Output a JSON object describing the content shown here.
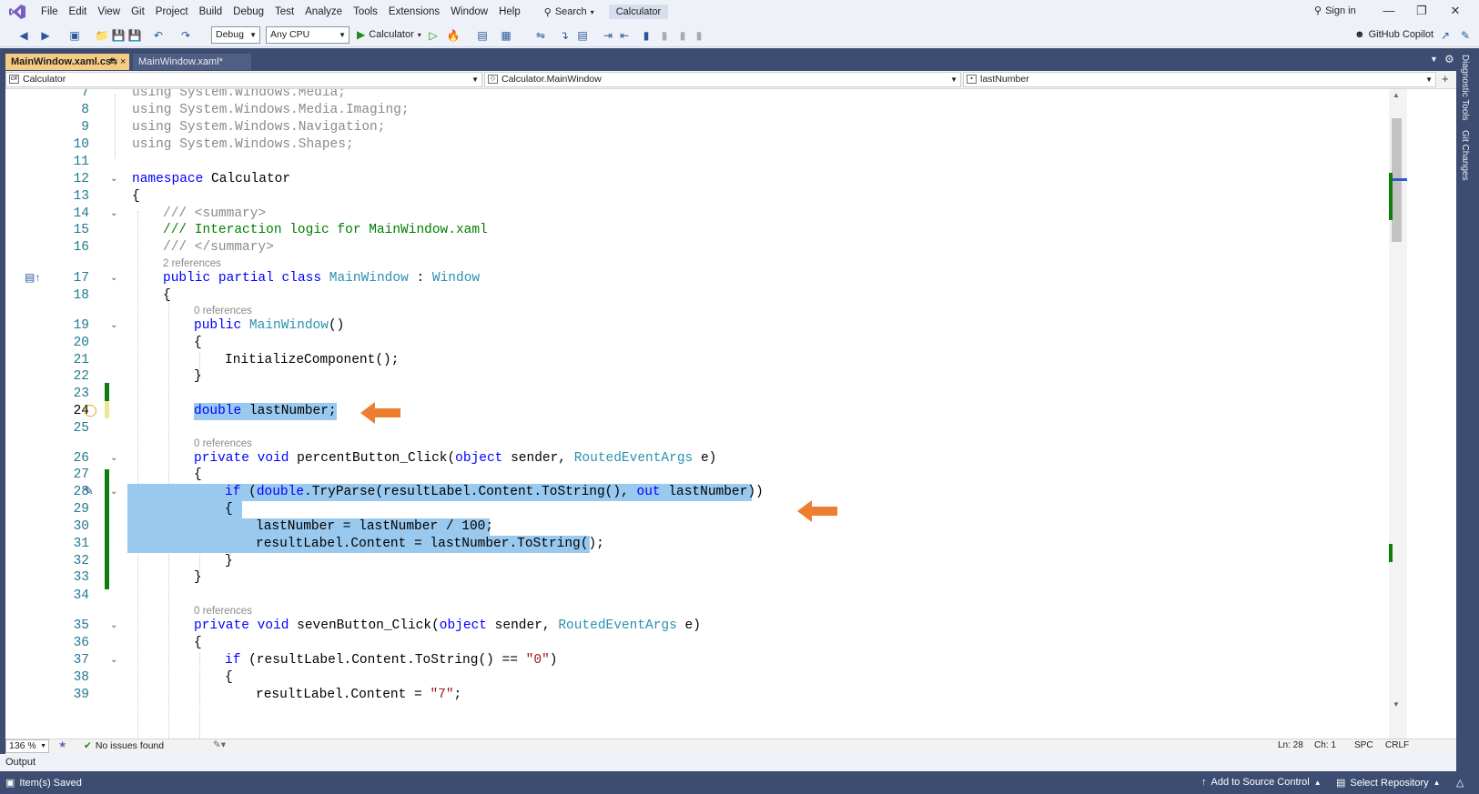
{
  "menu": {
    "items": [
      "File",
      "Edit",
      "View",
      "Git",
      "Project",
      "Build",
      "Debug",
      "Test",
      "Analyze",
      "Tools",
      "Extensions",
      "Window",
      "Help"
    ],
    "search_label": "Search",
    "solution_name": "Calculator",
    "sign_in": "Sign in"
  },
  "toolbar": {
    "configuration": "Debug",
    "platform": "Any CPU",
    "run_target": "Calculator",
    "copilot": "GitHub Copilot"
  },
  "tabs": [
    {
      "label": "MainWindow.xaml.cs*",
      "active": true
    },
    {
      "label": "MainWindow.xaml*",
      "active": false
    }
  ],
  "navbar": {
    "project": "Calculator",
    "type": "Calculator.MainWindow",
    "member": "lastNumber"
  },
  "side_panels": [
    "Diagnostic Tools",
    "Git Changes"
  ],
  "code": {
    "line_numbers": [
      "7",
      "8",
      "9",
      "10",
      "11",
      "12",
      "13",
      "14",
      "15",
      "16",
      "17",
      "18",
      "19",
      "20",
      "21",
      "22",
      "23",
      "24",
      "25",
      "26",
      "27",
      "28",
      "29",
      "30",
      "31",
      "32",
      "33",
      "34",
      "35",
      "36",
      "37",
      "38",
      "39"
    ],
    "lens_2_refs": "2 references",
    "lens_0_refs": "0 references",
    "l7_kw": "using",
    "l7_rest": " System.Windows.Media;",
    "l8_kw": "using",
    "l8_rest": " System.Windows.Media.Imaging;",
    "l9_kw": "using",
    "l9_rest": " System.Windows.Navigation;",
    "l10_kw": "using",
    "l10_rest": " System.Windows.Shapes;",
    "l12_kw": "namespace",
    "l12_rest": " Calculator",
    "brace_open": "{",
    "brace_close": "}",
    "l14": "/// <summary>",
    "l15": "/// Interaction logic for MainWindow.xaml",
    "l16": "/// </summary>",
    "l17_kw1": "public",
    "l17_kw2": "partial",
    "l17_kw3": "class",
    "l17_type": "MainWindow",
    "l17_colon": " : ",
    "l17_base": "Window",
    "l19_kw": "public",
    "l19_type": "MainWindow",
    "l19_rest": "()",
    "l21": "InitializeComponent();",
    "l24_kw": "double",
    "l24_rest": " lastNumber;",
    "l26_kw1": "private",
    "l26_kw2": "void",
    "l26_name": " percentButton_Click(",
    "l26_kw3": "object",
    "l26_mid": " sender, ",
    "l26_type": "RoutedEventArgs",
    "l26_end": " e)",
    "l28_kw1": "if",
    "l28_p1": " (",
    "l28_kw2": "double",
    "l28_mid": ".TryParse(resultLabel.Content.ToString(), ",
    "l28_kw3": "out",
    "l28_end": " lastNumber))",
    "l30": "lastNumber = lastNumber / 100;",
    "l31": "resultLabel.Content = lastNumber.ToString();",
    "l35_kw1": "private",
    "l35_kw2": "void",
    "l35_name": " sevenButton_Click(",
    "l35_kw3": "object",
    "l35_mid": " sender, ",
    "l35_type": "RoutedEventArgs",
    "l35_end": " e)",
    "l37_kw": "if",
    "l37_mid": " (resultLabel.Content.ToString() == ",
    "l37_str": "\"0\"",
    "l37_end": ")",
    "l39_pre": "resultLabel.Content = ",
    "l39_str": "\"7\"",
    "l39_end": ";"
  },
  "editor_status": {
    "zoom": "136 %",
    "issues": "No issues found",
    "ln": "Ln: 28",
    "ch": "Ch: 1",
    "spc": "SPC",
    "crlf": "CRLF"
  },
  "output_label": "Output",
  "statusbar": {
    "left": "Item(s) Saved",
    "source_control": "Add to Source Control",
    "repository": "Select Repository"
  },
  "colors": {
    "frame": "#3d4d72",
    "active_tab": "#f5cc84",
    "selection": "#99c9ef",
    "keyword": "#0000ff",
    "type": "#2b91af",
    "comment": "#008000",
    "string": "#a31515",
    "change_bar": "#107c10",
    "arrow": "#ed7d31"
  }
}
